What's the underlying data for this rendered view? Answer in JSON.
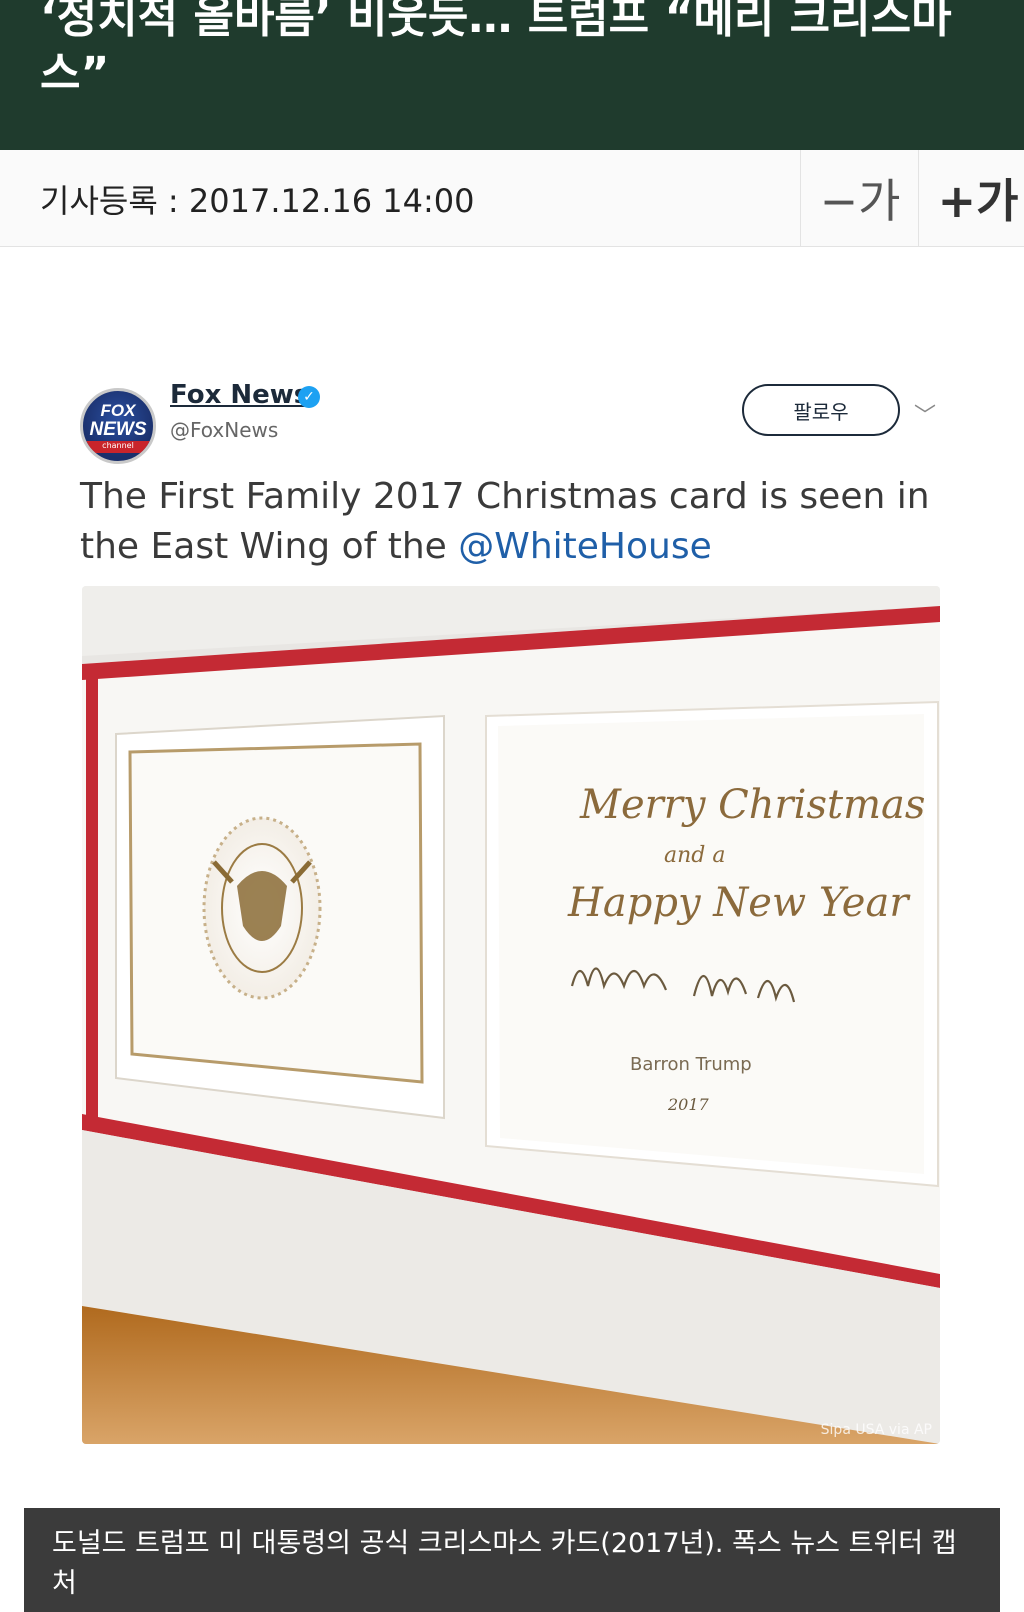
{
  "headline": {
    "text": "‘정치적 올바름’ 비웃듯… 트럼프 “메리 크리스마스”"
  },
  "meta": {
    "date_label": "기사등록 : 2017.12.16 14:00"
  },
  "font_controls": {
    "decrease": "−가",
    "increase": "+가"
  },
  "tweet": {
    "account": {
      "name": "Fox News",
      "handle": "@FoxNews",
      "verified_icon": "verified-badge-icon"
    },
    "avatar_logo": {
      "line1": "FOX",
      "line2": "NEWS",
      "line3": "channel"
    },
    "follow_label": "팔로우",
    "menu_icon": "chevron-down-icon",
    "text": "The First Family 2017 Christmas card is seen in the East Wing of the ",
    "mention": "@WhiteHouse",
    "photo": {
      "card_greeting_1": "Merry Christmas",
      "card_greeting_2": "and a",
      "card_greeting_3": "Happy New Year",
      "card_name": "Barron Trump",
      "card_year": "2017",
      "credit": "Sipa USA via AP"
    }
  },
  "caption": {
    "text": "도널드 트럼프 미 대통령의 공식 크리스마스 카드(2017년). 폭스 뉴스 트위터 캡처"
  },
  "colors": {
    "header_bg": "#1f3b2d",
    "caption_bg": "#3b3b3b",
    "link": "#1f5fa8",
    "frame_red": "#c42a34"
  }
}
